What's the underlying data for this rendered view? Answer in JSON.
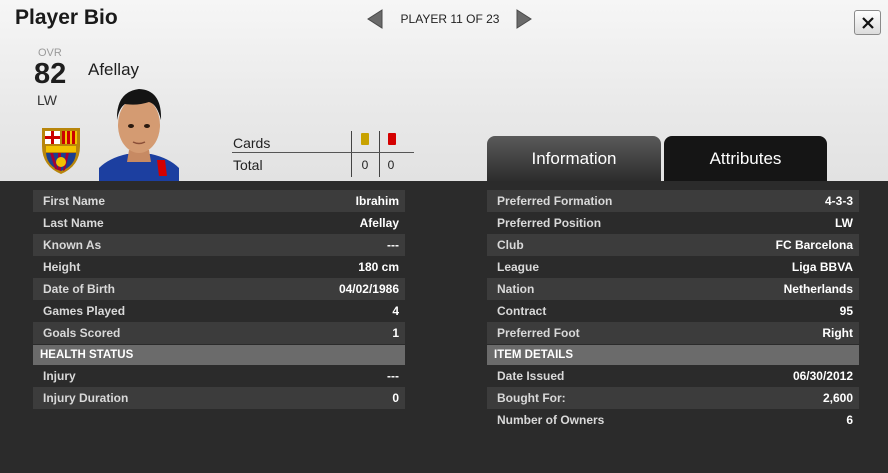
{
  "header": {
    "title": "Player Bio",
    "nav_label": "PLAYER 11 OF 23",
    "close_label": "×"
  },
  "player": {
    "ovr_label": "OVR",
    "ovr": "82",
    "position": "LW",
    "name": "Afellay"
  },
  "cards": {
    "row1_label": "Cards",
    "row2_label": "Total",
    "yellow_count": "0",
    "red_count": "0",
    "yellow_color": "#c8a200",
    "red_color": "#d40000"
  },
  "tabs": {
    "information": "Information",
    "attributes": "Attributes"
  },
  "left_panel": {
    "rows": [
      {
        "label": "First Name",
        "value": "Ibrahim"
      },
      {
        "label": "Last Name",
        "value": "Afellay"
      },
      {
        "label": "Known As",
        "value": "---"
      },
      {
        "label": "Height",
        "value": "180 cm"
      },
      {
        "label": "Date of Birth",
        "value": "04/02/1986"
      },
      {
        "label": "Games Played",
        "value": "4"
      },
      {
        "label": "Goals Scored",
        "value": "1"
      }
    ],
    "section_title": "HEALTH STATUS",
    "section_rows": [
      {
        "label": "Injury",
        "value": "---"
      },
      {
        "label": "Injury Duration",
        "value": "0"
      }
    ]
  },
  "right_panel": {
    "rows": [
      {
        "label": "Preferred Formation",
        "value": "4-3-3"
      },
      {
        "label": "Preferred Position",
        "value": "LW"
      },
      {
        "label": "Club",
        "value": "FC Barcelona"
      },
      {
        "label": "League",
        "value": "Liga BBVA"
      },
      {
        "label": "Nation",
        "value": "Netherlands"
      },
      {
        "label": "Contract",
        "value": "95"
      },
      {
        "label": "Preferred Foot",
        "value": "Right"
      }
    ],
    "section_title": "ITEM DETAILS",
    "section_rows": [
      {
        "label": "Date Issued",
        "value": "06/30/2012"
      },
      {
        "label": "Bought For:",
        "value": "2,600"
      },
      {
        "label": "Number of Owners",
        "value": "6"
      }
    ]
  },
  "icons": {
    "prev": "arrow-left-icon",
    "next": "arrow-right-icon",
    "close": "close-icon",
    "club": "club-crest-icon"
  }
}
